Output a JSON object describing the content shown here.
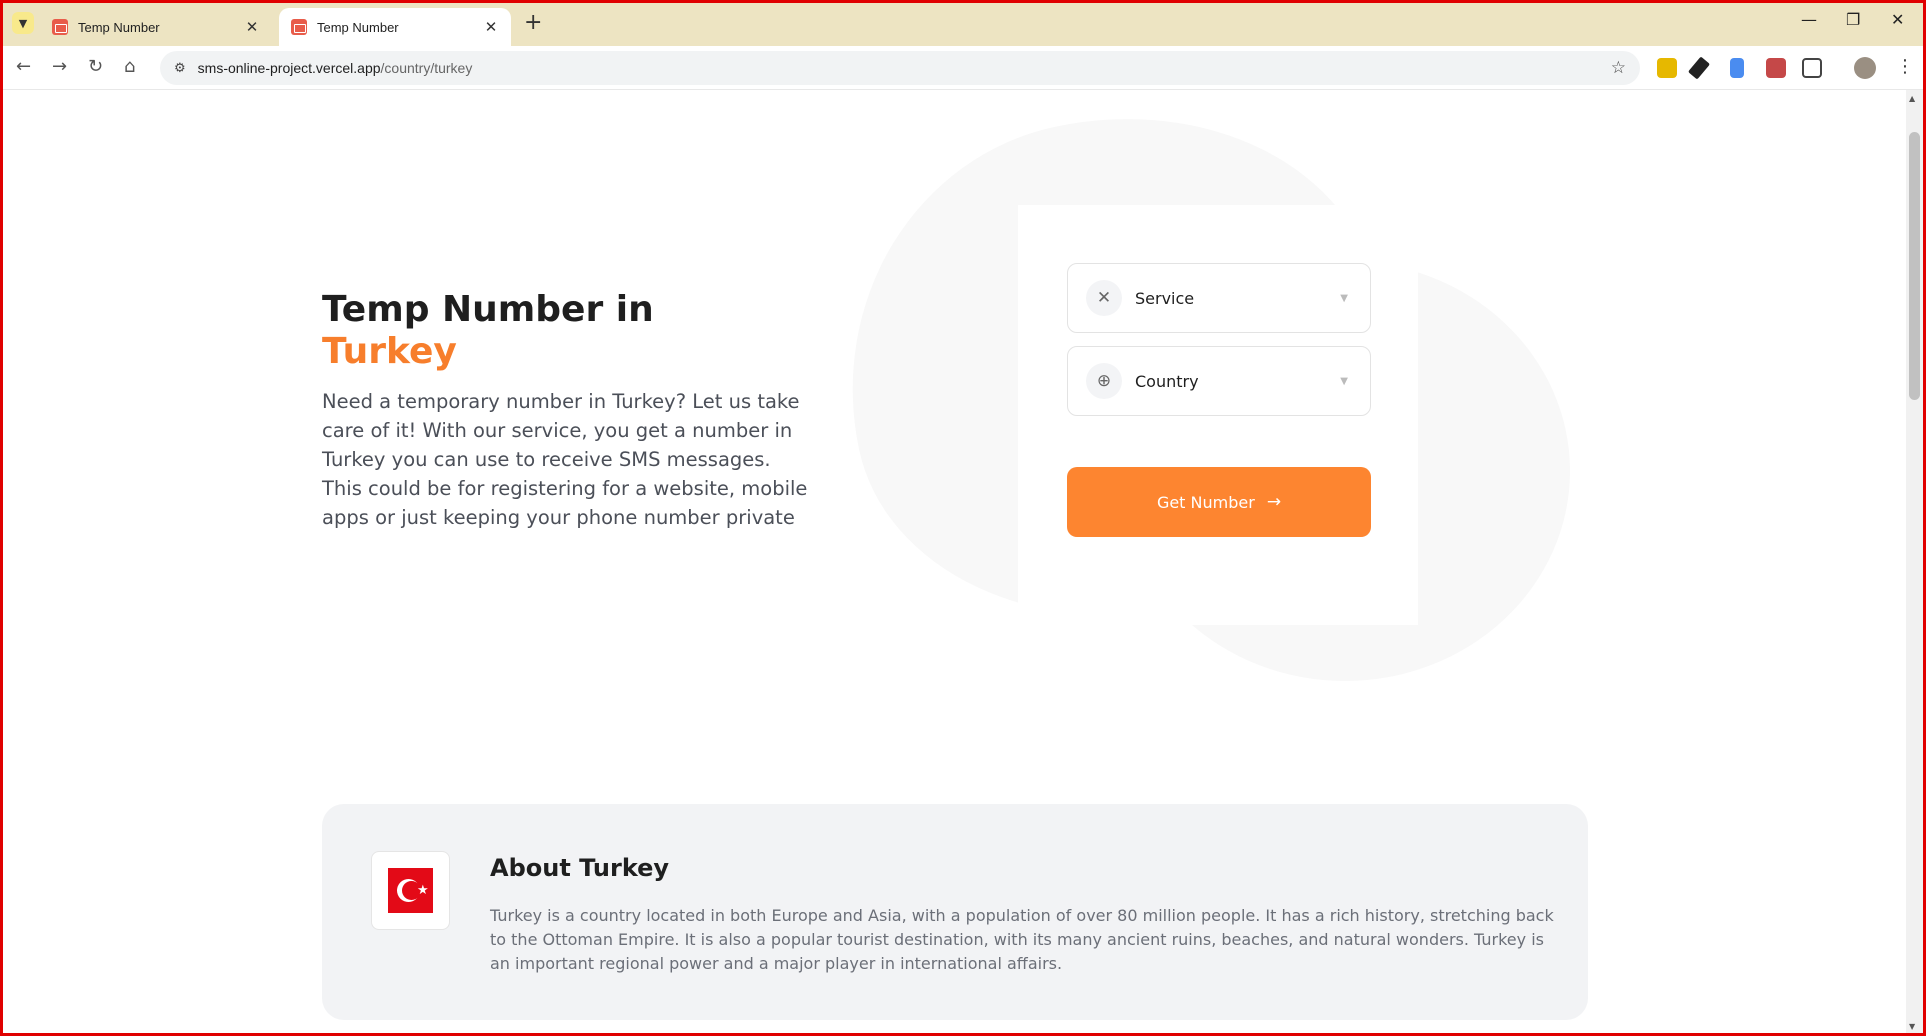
{
  "browser": {
    "tabs": [
      {
        "title": "Temp Number",
        "close": "✕"
      },
      {
        "title": "Temp Number",
        "close": "✕"
      }
    ],
    "new_tab": "+",
    "window_controls": {
      "minimize": "—",
      "restore": "❐",
      "close": "✕"
    },
    "address": {
      "host": "sms-online-project.vercel.app",
      "path": "/country/turkey"
    },
    "colors": {
      "tabbar": "#ede4c2",
      "frame": "#e00000"
    }
  },
  "hero": {
    "title": "Temp Number in",
    "country": "Turkey",
    "description": "Need a temporary number in Turkey? Let us take care of it! With our service, you get a number in Turkey you can use to receive SMS messages. This could be for registering for a website, mobile apps or just keeping your phone number private"
  },
  "form": {
    "service_label": "Service",
    "country_label": "Country",
    "button_label": "Get Number",
    "button_arrow": "→",
    "accent": "#fd8530",
    "service_icon": "tools-icon",
    "country_icon": "globe-icon"
  },
  "about": {
    "title": "About Turkey",
    "text": "Turkey is a country located in both Europe and Asia, with a population of over 80 million people. It has a rich history, stretching back to the Ottoman Empire. It is also a popular tourist destination, with its many ancient ruins, beaches, and natural wonders. Turkey is an important regional power and a major player in international affairs.",
    "flag": "turkey-flag-icon"
  }
}
